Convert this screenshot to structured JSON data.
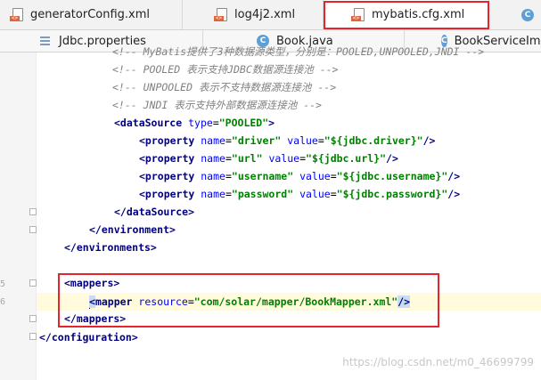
{
  "tabs_row1": [
    {
      "label": "generatorConfig.xml",
      "icon": "xml-file-icon"
    },
    {
      "label": "log4j2.xml",
      "icon": "xml-file-icon"
    },
    {
      "label": "mybatis.cfg.xml",
      "icon": "xml-file-icon",
      "active": true
    },
    {
      "label": "",
      "icon": "class-icon"
    }
  ],
  "tabs_row2": [
    {
      "label": "Jdbc.properties",
      "icon": "properties-file-icon"
    },
    {
      "label": "Book.java",
      "icon": "java-class-icon"
    },
    {
      "label": "BookServiceImp",
      "icon": "java-class-icon"
    }
  ],
  "line_numbers": [
    "",
    "",
    "",
    "",
    "",
    "",
    "",
    "",
    "",
    "",
    "",
    "",
    "",
    "",
    "5",
    "6",
    "",
    ""
  ],
  "code": {
    "l0": "<!-- MyBatis提供了3种数据源类型，分别是：POOLED,UNPOOLED,JNDI -->",
    "l1_comment": "<!-- POOLED 表示支持JDBC数据源连接池 -->",
    "l2_comment": "<!-- UNPOOLED 表示不支持数据源连接池 -->",
    "l3_comment": "<!-- JNDI 表示支持外部数据源连接池 -->",
    "ds_tag": "<dataSource",
    "ds_attr": "type",
    "ds_val": "\"POOLED\"",
    "prop_tag": "<property",
    "name_attr": "name",
    "value_attr": "value",
    "props": [
      {
        "name": "\"driver\"",
        "value": "\"${jdbc.driver}\""
      },
      {
        "name": "\"url\"",
        "value": "\"${jdbc.url}\""
      },
      {
        "name": "\"username\"",
        "value": "\"${jdbc.username}\""
      },
      {
        "name": "\"password\"",
        "value": "\"${jdbc.password}\""
      }
    ],
    "self_close": "/>",
    "gt": ">",
    "eq": "=",
    "ds_close": "</dataSource>",
    "env_close": "</environment>",
    "envs_close": "</environments>",
    "mappers_open": "<mappers>",
    "mapper_lt": "<",
    "mapper_name": "mapper",
    "mapper_attr": "resource",
    "mapper_val": "\"com/solar/mapper/BookMapper.xml\"",
    "mappers_close": "</mappers>",
    "config_close": "</configuration>"
  },
  "watermark": "https://blog.csdn.net/m0_46699799",
  "colors": {
    "tag": "#000080",
    "attr": "#0000ff",
    "value": "#008000",
    "comment": "#808080",
    "highlight_box": "#e4262c",
    "current_line": "#fffbdc"
  }
}
